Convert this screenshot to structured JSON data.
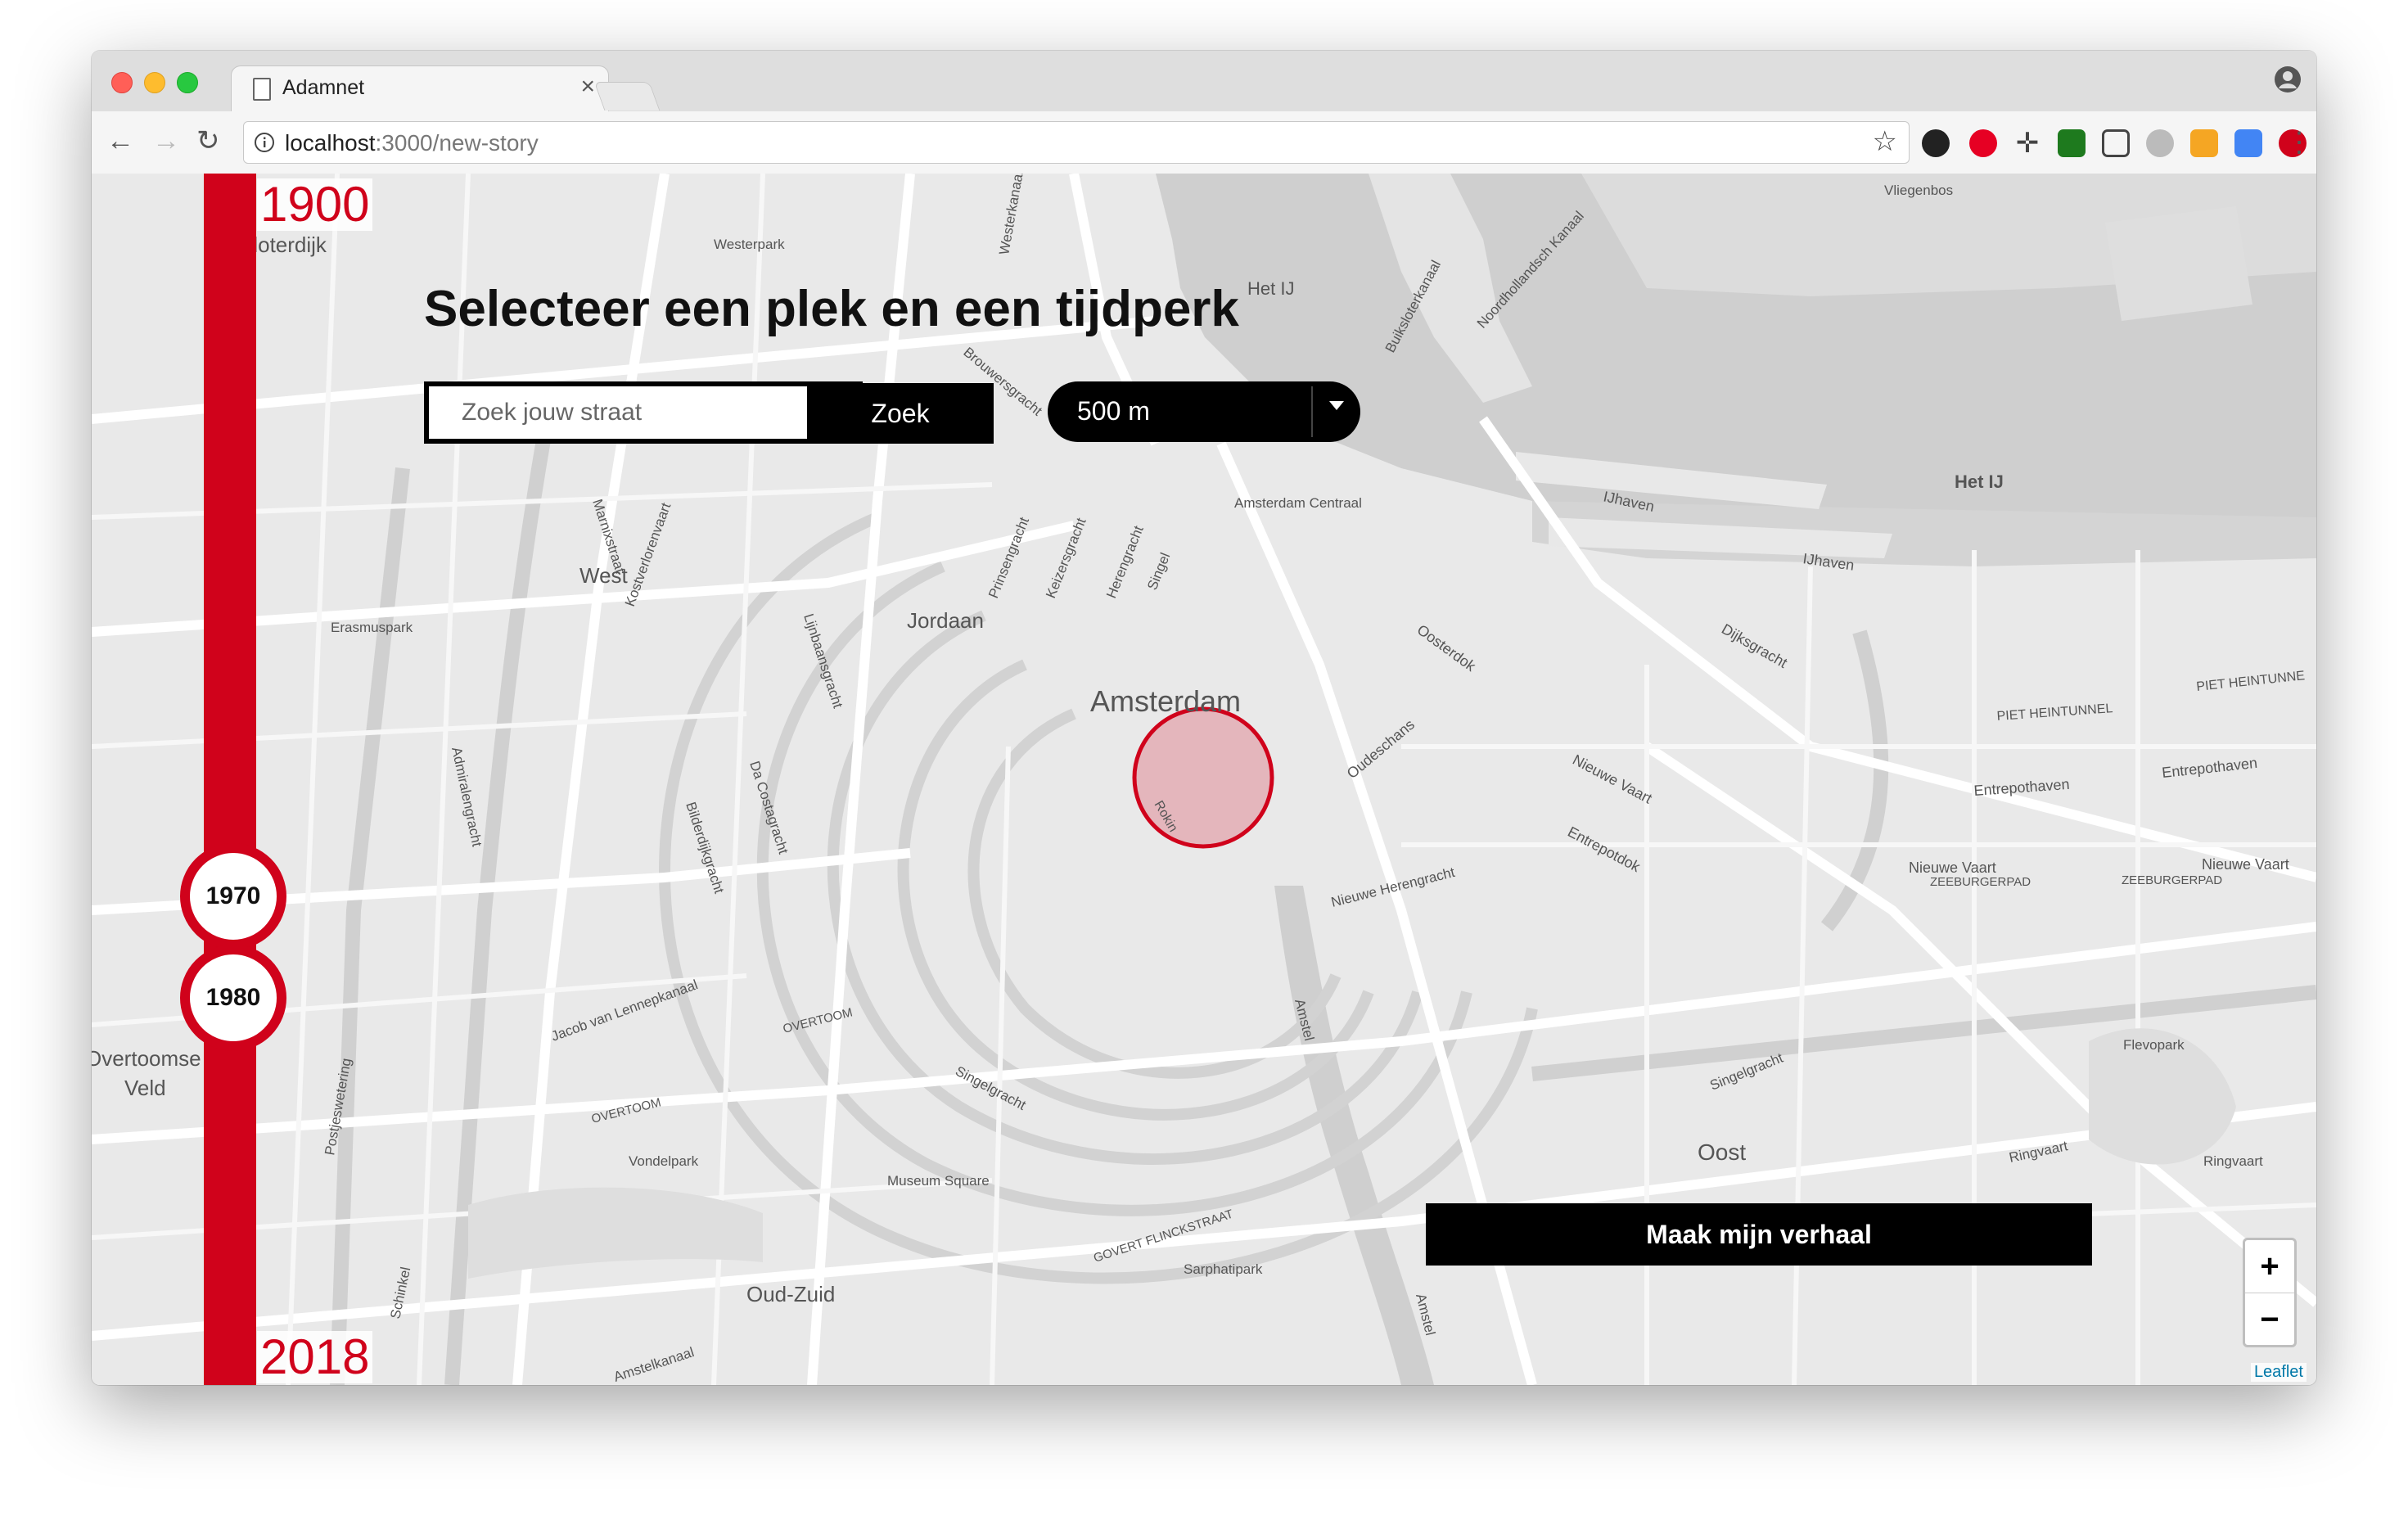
{
  "browser": {
    "tab_title": "Adamnet",
    "url_host": "localhost",
    "url_rest": ":3000/new-story",
    "colors": {
      "close": "#ff5f57",
      "minimize": "#febc2e",
      "maximize": "#28c840"
    }
  },
  "timeline": {
    "start_year": "1900",
    "end_year": "2018",
    "selected_from": "1970",
    "selected_to": "1980",
    "accent_color": "#d0021b"
  },
  "page": {
    "heading": "Selecteer een plek en een tijdperk",
    "search_placeholder": "Zoek jouw straat",
    "search_button": "Zoek",
    "radius_value": "500 m",
    "submit_button": "Maak mijn verhaal"
  },
  "map": {
    "zoom_in": "+",
    "zoom_out": "−",
    "attribution": "Leaflet",
    "labels": {
      "city": "Amsterdam",
      "jordaan": "Jordaan",
      "west": "West",
      "oost": "Oost",
      "oud_zuid": "Oud-Zuid",
      "het_ij": "Het IJ",
      "westerpark": "Westerpark",
      "erasmuspark": "Erasmuspark",
      "vondelpark": "Vondelpark",
      "museum_square": "Museum Square",
      "sarphatipark": "Sarphatipark",
      "flevopark": "Flevopark",
      "vliegenbos": "Vliegenbos",
      "amsterdam_centraal": "Amsterdam Centraal",
      "ijhaven1": "IJhaven",
      "ijhaven2": "IJhaven",
      "oosterdok": "Oosterdok",
      "dijksgracht": "Dijksgracht",
      "oudeschans": "Oudeschans",
      "nieuwe_vaart": "Nieuwe Vaart",
      "entrepotdok": "Entrepotdok",
      "entrepothaven1": "Entrepothaven",
      "entrepothaven2": "Entrepothaven",
      "piet_heintunnel1": "PIET HEINTUNNEL",
      "piet_heintunnel2": "PIET HEINTUNNE",
      "nieuwe_vaart2": "Nieuwe Vaart",
      "nieuwe_vaart3": "Nieuwe Vaart",
      "zeeburgerpad1": "ZEEBURGERPAD",
      "zeeburgerpad2": "ZEEBURGERPAD",
      "prinsengracht": "Prinsengracht",
      "keizersgracht": "Keizersgracht",
      "herengracht": "Herengracht",
      "singel": "Singel",
      "singelgracht": "Singelgracht",
      "lijnbaansgracht": "Lijnbaansgracht",
      "kostverlorenvaart": "Kostverlorenvaart",
      "admiralengracht": "Admiralengracht",
      "bilderdijkgracht": "Bilderdijkgracht",
      "da_costagracht": "Da Costagracht",
      "jacob_van_lennepkanaal": "Jacob van Lennepkanaal",
      "overtoom1": "OVERTOOM",
      "overtoom2": "OVERTOOM",
      "govert_flinckstraat": "GOVERT FLINCKSTRAAT",
      "amstel1": "Amstel",
      "amstel2": "Amstel",
      "nieuwe_herengracht": "Nieuwe Herengracht",
      "ringvaart1": "Ringvaart",
      "ringvaart2": "Ringvaart",
      "overtoomse_veld1": "Overtoomse",
      "overtoomse_veld2": "Veld",
      "brouwersgracht": "Brouwersgracht",
      "buiksloterkanaal": "Buiksloterkanaal",
      "noordhollandsch_kanaal": "Noordhollandsch Kanaal",
      "schinkel": "Schinkel",
      "postjeswetering": "Postjeswetering",
      "westerkanaal": "Westerkanaal",
      "marnixstraat": "Marnixstraat",
      "singelgracht2": "Singelgracht",
      "ijhaven3": "Het IJ",
      "rokin": "Rokin",
      "sloterdijk": "Sloterdijk",
      "amstelkanaal": "Amstelkanaal"
    }
  }
}
